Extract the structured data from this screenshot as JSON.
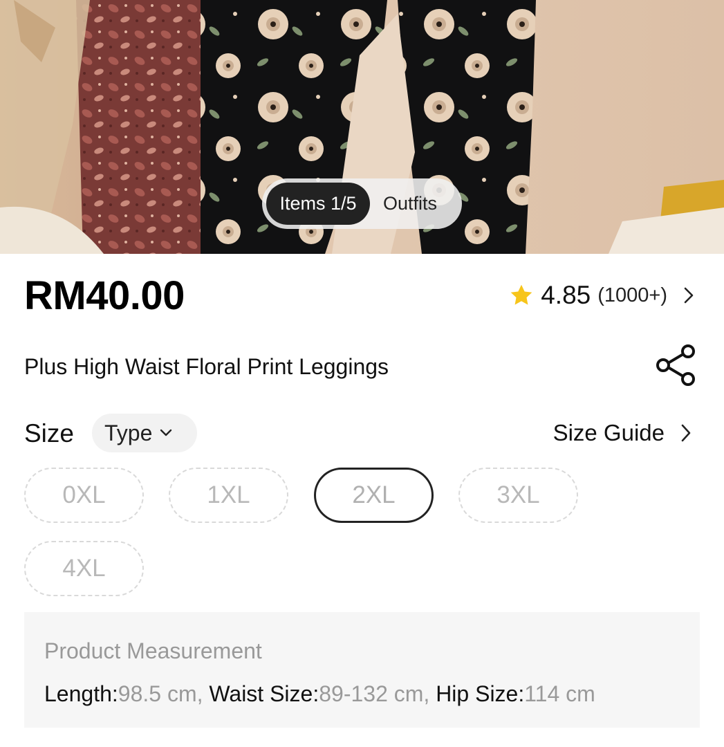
{
  "gallery": {
    "tab_items": "Items 1/5",
    "tab_outfits": "Outfits"
  },
  "product": {
    "price": "RM40.00",
    "rating_score": "4.85",
    "rating_count": "(1000+)",
    "title": "Plus High Waist Floral Print Leggings"
  },
  "size_section": {
    "label": "Size",
    "type_label": "Type",
    "guide_label": "Size Guide",
    "options": [
      {
        "label": "0XL",
        "state": "unavailable"
      },
      {
        "label": "1XL",
        "state": "unavailable"
      },
      {
        "label": "2XL",
        "state": "selected"
      },
      {
        "label": "3XL",
        "state": "unavailable"
      },
      {
        "label": "4XL",
        "state": "unavailable"
      }
    ]
  },
  "measurement": {
    "title": "Product Measurement",
    "items": [
      {
        "key": "Length:",
        "value": "98.5 cm"
      },
      {
        "key": "Waist Size:",
        "value": "89-132 cm"
      },
      {
        "key": "Hip Size:",
        "value": "114 cm"
      }
    ],
    "separator": ", "
  },
  "icons": {
    "rating": "star-icon",
    "rating_arrow": "chevron-right-icon",
    "share": "share-icon",
    "type_arrow": "chevron-down-icon",
    "guide_arrow": "chevron-right-icon"
  },
  "colors": {
    "star": "#f7c51b",
    "tab_active_bg": "#222222",
    "measure_bg": "#f6f6f6"
  }
}
